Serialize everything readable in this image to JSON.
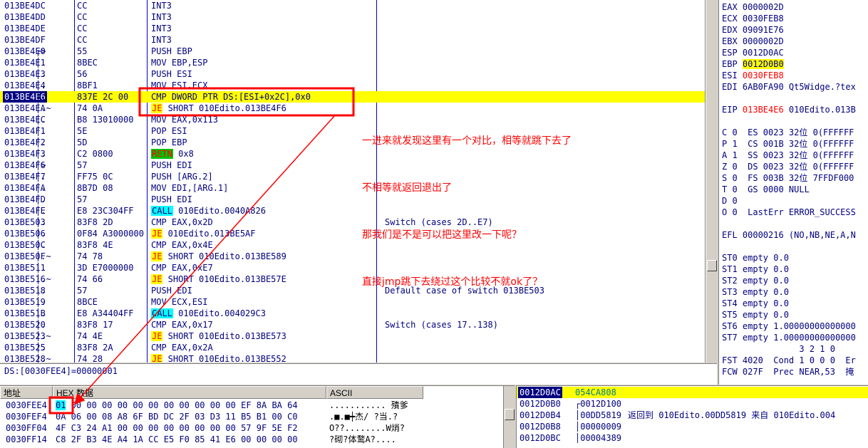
{
  "disasm": {
    "rows": [
      {
        "addr": "013BE4DC",
        "mark": "",
        "hex": "CC",
        "instr": "INT3",
        "instr_tag": "",
        "instr_rest": "",
        "comment": ""
      },
      {
        "addr": "013BE4DD",
        "mark": "",
        "hex": "CC",
        "instr": "INT3",
        "instr_tag": "",
        "instr_rest": "",
        "comment": ""
      },
      {
        "addr": "013BE4DE",
        "mark": "",
        "hex": "CC",
        "instr": "INT3",
        "instr_tag": "",
        "instr_rest": "",
        "comment": ""
      },
      {
        "addr": "013BE4DF",
        "mark": "",
        "hex": "CC",
        "instr": "INT3",
        "instr_tag": "",
        "instr_rest": "",
        "comment": ""
      },
      {
        "addr": "013BE4E0",
        "mark": "┌>",
        "hex": "55",
        "instr": "PUSH EBP",
        "instr_tag": "",
        "instr_rest": "",
        "comment": ""
      },
      {
        "addr": "013BE4E1",
        "mark": "│.",
        "hex": "8BEC",
        "instr": "MOV EBP,ESP",
        "instr_tag": "",
        "instr_rest": "",
        "comment": ""
      },
      {
        "addr": "013BE4E3",
        "mark": "│.",
        "hex": "56",
        "instr": "PUSH ESI",
        "instr_tag": "",
        "instr_rest": "",
        "comment": ""
      },
      {
        "addr": "013BE4E4",
        "mark": "│.",
        "hex": "8BF1",
        "instr": "MOV ESI,ECX",
        "instr_tag": "",
        "instr_rest": "",
        "comment": ""
      },
      {
        "addr": "013BE4E6",
        "mark": "│.",
        "hex": "837E 2C 00",
        "instr": "CMP DWORD PTR DS:[ESI+0x2C],0x0",
        "instr_tag": "",
        "instr_rest": "",
        "comment": ""
      },
      {
        "addr": "013BE4EA",
        "mark": "│.~",
        "hex": "74 0A",
        "instr": "",
        "instr_tag": "JE",
        "instr_rest": " SHORT 010Edito.013BE4F6",
        "comment": ""
      },
      {
        "addr": "013BE4EC",
        "mark": "│.",
        "hex": "B8 13010000",
        "instr": "MOV EAX,0x113",
        "instr_tag": "",
        "instr_rest": "",
        "comment": ""
      },
      {
        "addr": "013BE4F1",
        "mark": "│.",
        "hex": "5E",
        "instr": "POP ESI",
        "instr_tag": "",
        "instr_rest": "",
        "comment": ""
      },
      {
        "addr": "013BE4F2",
        "mark": "│.",
        "hex": "5D",
        "instr": "POP EBP",
        "instr_tag": "",
        "instr_rest": "",
        "comment": ""
      },
      {
        "addr": "013BE4F3",
        "mark": "│.",
        "hex": "C2 0800",
        "instr": "",
        "instr_tag": "RETN",
        "instr_rest": " 0x8",
        "comment": ""
      },
      {
        "addr": "013BE4F6",
        "mark": "│>",
        "hex": "57",
        "instr": "PUSH EDI",
        "instr_tag": "",
        "instr_rest": "",
        "comment": ""
      },
      {
        "addr": "013BE4F7",
        "mark": "│.",
        "hex": "FF75 0C",
        "instr": "PUSH [ARG.2]",
        "instr_tag": "",
        "instr_rest": "",
        "comment": ""
      },
      {
        "addr": "013BE4FA",
        "mark": "│.",
        "hex": "8B7D 08",
        "instr": "MOV EDI,[ARG.1]",
        "instr_tag": "",
        "instr_rest": "",
        "comment": ""
      },
      {
        "addr": "013BE4FD",
        "mark": "│.",
        "hex": "57",
        "instr": "PUSH EDI",
        "instr_tag": "",
        "instr_rest": "",
        "comment": ""
      },
      {
        "addr": "013BE4FE",
        "mark": "│.",
        "hex": "E8 23C304FF",
        "instr": "",
        "instr_tag": "CALL",
        "instr_rest": " 010Edito.0040A826",
        "comment": ""
      },
      {
        "addr": "013BE503",
        "mark": "│.",
        "hex": "83F8 2D",
        "instr": "CMP EAX,0x2D",
        "instr_tag": "",
        "instr_rest": "",
        "comment": "Switch (cases 2D..E7)"
      },
      {
        "addr": "013BE506",
        "mark": "│.",
        "hex": "0F84 A3000000",
        "instr": "",
        "instr_tag": "JE",
        "instr_rest": " 010Edito.013BE5AF",
        "comment": ""
      },
      {
        "addr": "013BE50C",
        "mark": "│.",
        "hex": "83F8 4E",
        "instr": "CMP EAX,0x4E",
        "instr_tag": "",
        "instr_rest": "",
        "comment": ""
      },
      {
        "addr": "013BE50F",
        "mark": "│.~",
        "hex": "74 78",
        "instr": "",
        "instr_tag": "JE",
        "instr_rest": " SHORT 010Edito.013BE589",
        "comment": ""
      },
      {
        "addr": "013BE511",
        "mark": "│.",
        "hex": "3D E7000000",
        "instr": "CMP EAX,0xE7",
        "instr_tag": "",
        "instr_rest": "",
        "comment": ""
      },
      {
        "addr": "013BE516",
        "mark": "│.~",
        "hex": "74 66",
        "instr": "",
        "instr_tag": "JE",
        "instr_rest": " SHORT 010Edito.013BE57E",
        "comment": ""
      },
      {
        "addr": "013BE518",
        "mark": "│.",
        "hex": "57",
        "instr": "PUSH EDI",
        "instr_tag": "",
        "instr_rest": "",
        "comment": "Default case of switch 013BE503"
      },
      {
        "addr": "013BE519",
        "mark": "│.",
        "hex": "8BCE",
        "instr": "MOV ECX,ESI",
        "instr_tag": "",
        "instr_rest": "",
        "comment": ""
      },
      {
        "addr": "013BE51B",
        "mark": "│.",
        "hex": "E8 A34404FF",
        "instr": "",
        "instr_tag": "CALL",
        "instr_rest": " 010Edito.004029C3",
        "comment": ""
      },
      {
        "addr": "013BE520",
        "mark": "│.",
        "hex": "83F8 17",
        "instr": "CMP EAX,0x17",
        "instr_tag": "",
        "instr_rest": "",
        "comment": "Switch (cases 17..138)"
      },
      {
        "addr": "013BE523",
        "mark": "│.~",
        "hex": "74 4E",
        "instr": "",
        "instr_tag": "JE",
        "instr_rest": " SHORT 010Edito.013BE573",
        "comment": ""
      },
      {
        "addr": "013BE525",
        "mark": "│.",
        "hex": "83F8 2A",
        "instr": "CMP EAX,0x2A",
        "instr_tag": "",
        "instr_rest": "",
        "comment": ""
      },
      {
        "addr": "013BE528",
        "mark": "│.~",
        "hex": "74 28",
        "instr": "",
        "instr_tag": "JE",
        "instr_rest": " SHORT 010Edito.013BE552",
        "comment": ""
      }
    ]
  },
  "info_line": "DS:[0030FEE4]=00000001",
  "registers": {
    "lines": [
      {
        "text": "EAX 0000002D",
        "hl": "",
        "red": ""
      },
      {
        "text": "ECX 0030FEB8",
        "hl": "",
        "red": ""
      },
      {
        "text": "EDX 09091E76",
        "hl": "",
        "red": ""
      },
      {
        "text": "EBX 0000002D",
        "hl": "",
        "red": ""
      },
      {
        "text": "ESP 0012D0AC",
        "hl": "",
        "red": ""
      },
      {
        "text": "EBP ",
        "hl": "0012D0B0",
        "red": ""
      },
      {
        "text": "ESI ",
        "hl": "",
        "red": "0030FEB8"
      },
      {
        "text": "EDI 6AB0FA90 Qt5Widge.?tex",
        "hl": "",
        "red": ""
      },
      {
        "text": "",
        "hl": "",
        "red": ""
      },
      {
        "text": "EIP ",
        "hl": "",
        "red": "013BE4E6",
        "after": " 010Edito.013B"
      },
      {
        "text": "",
        "hl": "",
        "red": ""
      },
      {
        "text": "C 0  ES 0023 32位 0(FFFFFF",
        "hl": "",
        "red": ""
      },
      {
        "text": "P 1  CS 001B 32位 0(FFFFFF",
        "hl": "",
        "red": ""
      },
      {
        "text": "A 1  SS 0023 32位 0(FFFFFF",
        "hl": "",
        "red": ""
      },
      {
        "text": "Z 0  DS 0023 32位 0(FFFFFF",
        "hl": "",
        "red": ""
      },
      {
        "text": "S 0  FS 003B 32位 7FFDF000",
        "hl": "",
        "red": ""
      },
      {
        "text": "T 0  GS 0000 NULL",
        "hl": "",
        "red": ""
      },
      {
        "text": "D 0",
        "hl": "",
        "red": ""
      },
      {
        "text": "O 0  LastErr ERROR_SUCCESS",
        "hl": "",
        "red": ""
      },
      {
        "text": "",
        "hl": "",
        "red": ""
      },
      {
        "text": "EFL 00000216 (NO,NB,NE,A,N",
        "hl": "",
        "red": ""
      },
      {
        "text": "",
        "hl": "",
        "red": ""
      },
      {
        "text": "ST0 empty 0.0",
        "hl": "",
        "red": ""
      },
      {
        "text": "ST1 empty 0.0",
        "hl": "",
        "red": ""
      },
      {
        "text": "ST2 empty 0.0",
        "hl": "",
        "red": ""
      },
      {
        "text": "ST3 empty 0.0",
        "hl": "",
        "red": ""
      },
      {
        "text": "ST4 empty 0.0",
        "hl": "",
        "red": ""
      },
      {
        "text": "ST5 empty 0.0",
        "hl": "",
        "red": ""
      },
      {
        "text": "ST6 empty 1.00000000000000",
        "hl": "",
        "red": ""
      },
      {
        "text": "ST7 empty 1.00000000000000",
        "hl": "",
        "red": ""
      },
      {
        "text": "               3 2 1 0",
        "hl": "",
        "red": ""
      },
      {
        "text": "FST 4020  Cond 1 0 0 0  Er",
        "hl": "",
        "red": ""
      },
      {
        "text": "FCW 027F  Prec NEAR,53  掩",
        "hl": "",
        "red": ""
      }
    ]
  },
  "dump": {
    "headers": {
      "addr": "地址",
      "hex": "HEX 数据",
      "ascii": "ASCII"
    },
    "rows": [
      {
        "addr": "0030FEE4",
        "first": "01",
        "hex": " 00 00 00 00 00 00 00 00 00 00 00 EF 8A BA 64",
        "ascii": "........... 殨爹"
      },
      {
        "addr": "0030FEF4",
        "first": "",
        "hex": "0A 06 00 08 A8 6F BD DC 2F 03 D3 11 B5 B1 00 C0",
        "ascii": ".■.■┿杰/ ?当.?"
      },
      {
        "addr": "0030FF04",
        "first": "",
        "hex": "4F C3 24 A1 00 00 00 00 00 00 00 00 57 9F 5E F2",
        "ascii": "O??........W焇?"
      },
      {
        "addr": "0030FF14",
        "first": "",
        "hex": "C8 2F B3 4E A4 1A CC E5 F0 85 41 E6 00 00 00 00",
        "ascii": "?砌?体鹜A?...."
      }
    ]
  },
  "stack": {
    "rows": [
      {
        "addr": "0012D0AC",
        "val": "054CA808",
        "com": "",
        "top": true
      },
      {
        "addr": "0012D0B0",
        "val": "┌0012D100",
        "com": "",
        "top": false
      },
      {
        "addr": "0012D0B4",
        "val": "│00DD5819",
        "com": "返回到 010Edito.00DD5819 来自 010Edito.004",
        "top": false
      },
      {
        "addr": "0012D0B8",
        "val": "│00000009",
        "com": "",
        "top": false
      },
      {
        "addr": "0012D0BC",
        "val": "│00004389",
        "com": "",
        "top": false
      }
    ]
  },
  "annotation": {
    "lines": [
      "一进来就发现这里有一个对比，相等就跳下去了",
      "不相等就返回退出了",
      "那我们是不是可以把这里改一下呢？",
      "直接jmp跳下去绕过这个比较不就ok了？"
    ],
    "color": "#ff0000"
  },
  "colors": {
    "selection": "#000080",
    "highlight": "#ffff00",
    "call": "#00ffff",
    "retn": "#00c000",
    "annotation": "#ff0000"
  }
}
